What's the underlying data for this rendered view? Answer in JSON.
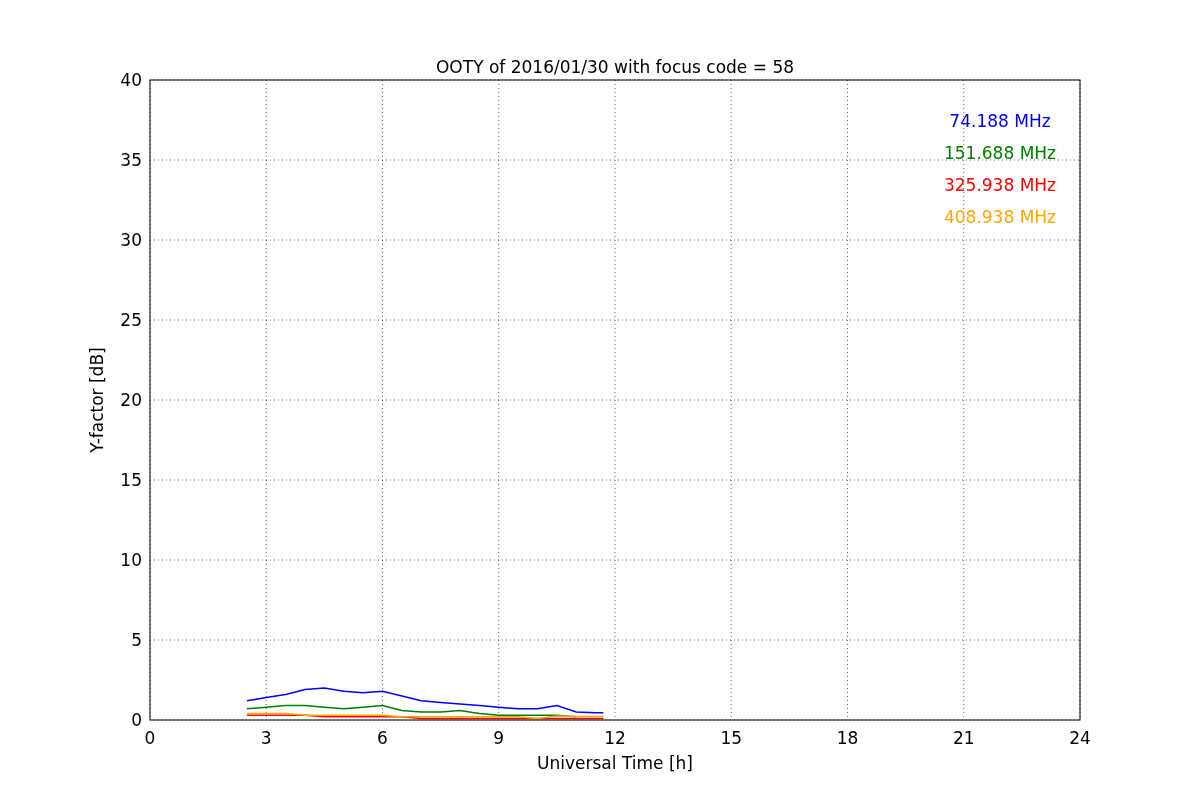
{
  "chart_data": {
    "type": "line",
    "title": "OOTY of 2016/01/30 with focus code = 58",
    "xlabel": "Universal Time [h]",
    "ylabel": "Y-factor [dB]",
    "x": [
      2.5,
      3,
      3.5,
      4,
      4.5,
      5,
      5.5,
      6,
      6.5,
      7,
      7.5,
      8,
      8.5,
      9,
      9.5,
      10,
      10.5,
      11,
      11.5,
      11.7
    ],
    "series": [
      {
        "name": "74.188 MHz",
        "color": "#0000ff",
        "values": [
          1.2,
          1.4,
          1.6,
          1.9,
          2.0,
          1.8,
          1.7,
          1.8,
          1.5,
          1.2,
          1.1,
          1.0,
          0.9,
          0.8,
          0.7,
          0.7,
          0.9,
          0.5,
          0.45,
          0.45
        ]
      },
      {
        "name": "151.688 MHz",
        "color": "#008000",
        "values": [
          0.7,
          0.8,
          0.9,
          0.9,
          0.8,
          0.7,
          0.8,
          0.9,
          0.6,
          0.5,
          0.5,
          0.6,
          0.4,
          0.3,
          0.3,
          0.3,
          0.3,
          0.2,
          null,
          null
        ]
      },
      {
        "name": "325.938 MHz",
        "color": "#ff0000",
        "values": [
          0.3,
          0.3,
          0.3,
          0.3,
          0.2,
          0.2,
          0.2,
          0.2,
          0.2,
          0.1,
          0.1,
          0.1,
          0.1,
          0.1,
          0.1,
          0.1,
          0.1,
          0.1,
          0.1,
          0.1
        ]
      },
      {
        "name": "408.938 MHz",
        "color": "#ffa500",
        "values": [
          0.4,
          0.4,
          0.4,
          0.3,
          0.3,
          0.3,
          0.3,
          0.3,
          0.2,
          0.2,
          0.2,
          0.2,
          0.2,
          0.2,
          0.2,
          0.1,
          0.25,
          0.22,
          0.22,
          0.22
        ]
      }
    ],
    "grid": true,
    "xlim": [
      0,
      24
    ],
    "ylim": [
      0,
      40
    ],
    "xticks": [
      0,
      3,
      6,
      9,
      12,
      15,
      18,
      21,
      24
    ],
    "yticks": [
      0,
      5,
      10,
      15,
      20,
      25,
      30,
      35,
      40
    ]
  }
}
